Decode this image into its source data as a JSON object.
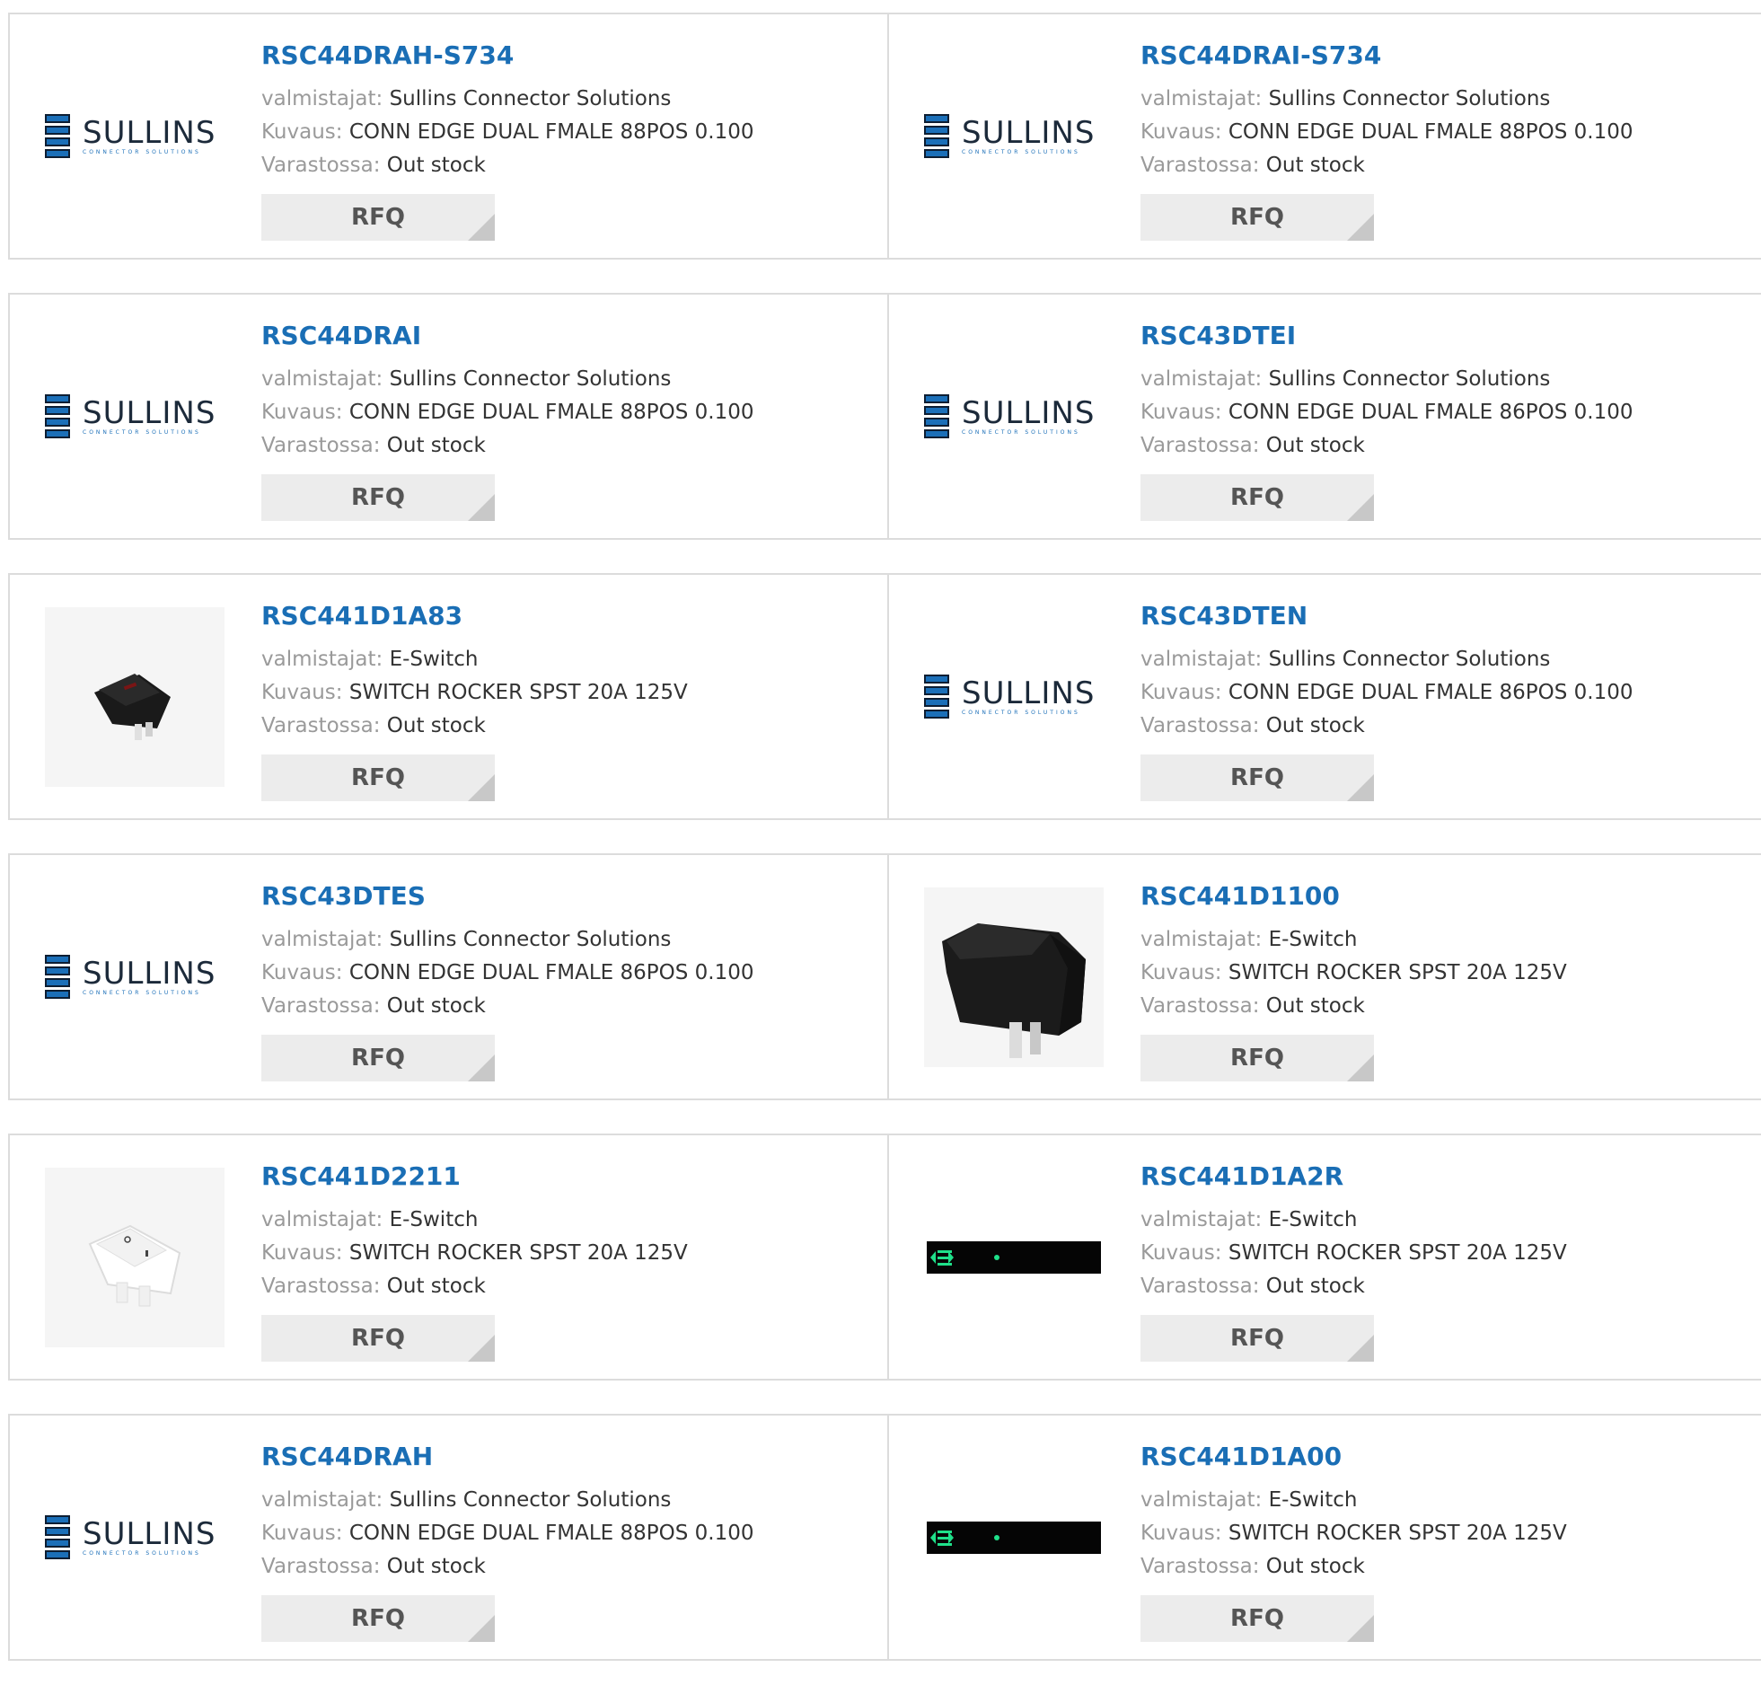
{
  "labels": {
    "manufacturer": "valmistajat:",
    "description": "Kuvaus:",
    "stock": "Varastossa:",
    "rfq": "RFQ"
  },
  "logo_text": {
    "sullins_main": "SULLINS",
    "sullins_sub": "CONNECTOR SOLUTIONS"
  },
  "products": [
    {
      "part": "RSC44DRAH-S734",
      "manufacturer": "Sullins Connector Solutions",
      "description": "CONN EDGE DUAL FMALE 88POS 0.100",
      "stock": "Out stock",
      "image": "sullins-logo"
    },
    {
      "part": "RSC44DRAI-S734",
      "manufacturer": "Sullins Connector Solutions",
      "description": "CONN EDGE DUAL FMALE 88POS 0.100",
      "stock": "Out stock",
      "image": "sullins-logo"
    },
    {
      "part": "RSC44DRAI",
      "manufacturer": "Sullins Connector Solutions",
      "description": "CONN EDGE DUAL FMALE 88POS 0.100",
      "stock": "Out stock",
      "image": "sullins-logo"
    },
    {
      "part": "RSC43DTEI",
      "manufacturer": "Sullins Connector Solutions",
      "description": "CONN EDGE DUAL FMALE 86POS 0.100",
      "stock": "Out stock",
      "image": "sullins-logo"
    },
    {
      "part": "RSC441D1A83",
      "manufacturer": "E-Switch",
      "description": "SWITCH ROCKER SPST 20A 125V",
      "stock": "Out stock",
      "image": "black-rocker-switch-small"
    },
    {
      "part": "RSC43DTEN",
      "manufacturer": "Sullins Connector Solutions",
      "description": "CONN EDGE DUAL FMALE 86POS 0.100",
      "stock": "Out stock",
      "image": "sullins-logo"
    },
    {
      "part": "RSC43DTES",
      "manufacturer": "Sullins Connector Solutions",
      "description": "CONN EDGE DUAL FMALE 86POS 0.100",
      "stock": "Out stock",
      "image": "sullins-logo"
    },
    {
      "part": "RSC441D1100",
      "manufacturer": "E-Switch",
      "description": "SWITCH ROCKER SPST 20A 125V",
      "stock": "Out stock",
      "image": "black-rocker-switch-large"
    },
    {
      "part": "RSC441D2211",
      "manufacturer": "E-Switch",
      "description": "SWITCH ROCKER SPST 20A 125V",
      "stock": "Out stock",
      "image": "white-rocker-switch"
    },
    {
      "part": "RSC441D1A2R",
      "manufacturer": "E-Switch",
      "description": "SWITCH ROCKER SPST 20A 125V",
      "stock": "Out stock",
      "image": "led-strip"
    },
    {
      "part": "RSC44DRAH",
      "manufacturer": "Sullins Connector Solutions",
      "description": "CONN EDGE DUAL FMALE 88POS 0.100",
      "stock": "Out stock",
      "image": "sullins-logo"
    },
    {
      "part": "RSC441D1A00",
      "manufacturer": "E-Switch",
      "description": "SWITCH ROCKER SPST 20A 125V",
      "stock": "Out stock",
      "image": "led-strip"
    }
  ],
  "colors": {
    "link": "#1a6eb5",
    "label": "#9a9a9a",
    "value": "#333333",
    "border": "#dcdcdc",
    "rfq_bg": "#ececec"
  }
}
